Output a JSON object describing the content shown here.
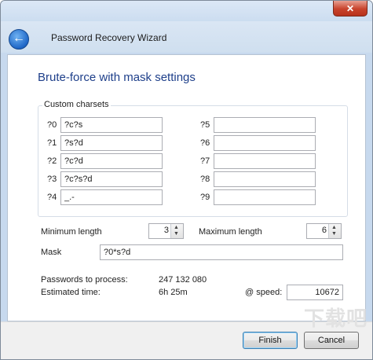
{
  "window": {
    "title": "Password Recovery Wizard",
    "close_symbol": "✕"
  },
  "header": {
    "back_symbol": "←"
  },
  "main": {
    "heading": "Brute-force with mask settings"
  },
  "charsets": {
    "group_label": "Custom charsets",
    "left": [
      {
        "label": "?0",
        "value": "?c?s"
      },
      {
        "label": "?1",
        "value": "?s?d"
      },
      {
        "label": "?2",
        "value": "?c?d"
      },
      {
        "label": "?3",
        "value": "?c?s?d"
      },
      {
        "label": "?4",
        "value": "_.-"
      }
    ],
    "right": [
      {
        "label": "?5",
        "value": ""
      },
      {
        "label": "?6",
        "value": ""
      },
      {
        "label": "?7",
        "value": ""
      },
      {
        "label": "?8",
        "value": ""
      },
      {
        "label": "?9",
        "value": ""
      }
    ]
  },
  "length": {
    "min_label": "Minimum length",
    "min_value": "3",
    "max_label": "Maximum length",
    "max_value": "6"
  },
  "mask": {
    "label": "Mask",
    "value": "?0*s?d"
  },
  "stats": {
    "passwords_label": "Passwords to process:",
    "passwords_value": "247 132 080",
    "time_label": "Estimated time:",
    "time_value": "6h 25m",
    "speed_label": "@ speed:",
    "speed_value": "10672"
  },
  "buttons": {
    "finish": "Finish",
    "cancel": "Cancel"
  },
  "watermark": "下载吧"
}
